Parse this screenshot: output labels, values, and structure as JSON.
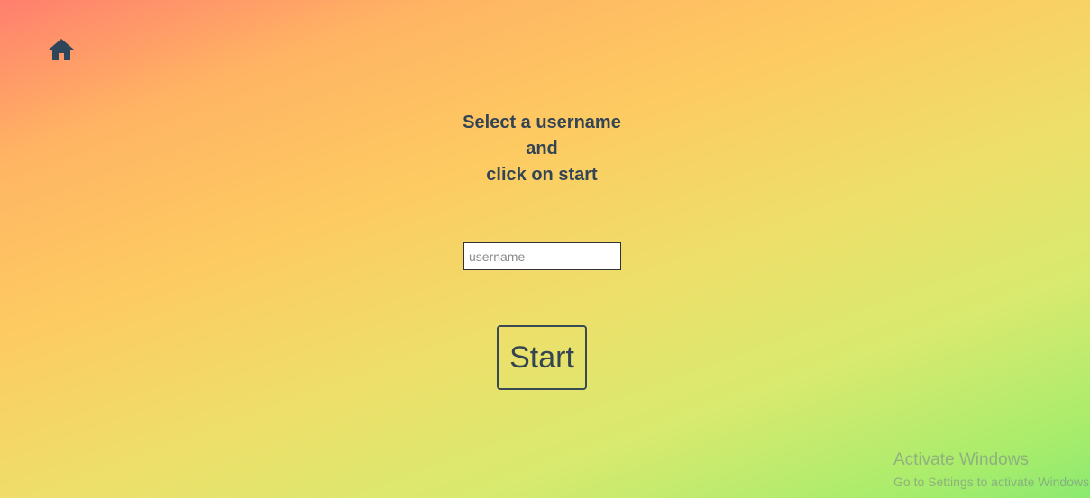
{
  "header": {
    "home_icon": "home-icon"
  },
  "prompt": {
    "line1": "Select a username",
    "line2": "and",
    "line3": "click on start"
  },
  "form": {
    "username_placeholder": "username",
    "username_value": "",
    "start_label": "Start"
  },
  "watermark": {
    "title": "Activate Windows",
    "subtitle": "Go to Settings to activate Windows."
  },
  "colors": {
    "text": "#334455",
    "gradient_start": "#ff7f6e",
    "gradient_mid": "#fdcb62",
    "gradient_end": "#8bea70"
  }
}
